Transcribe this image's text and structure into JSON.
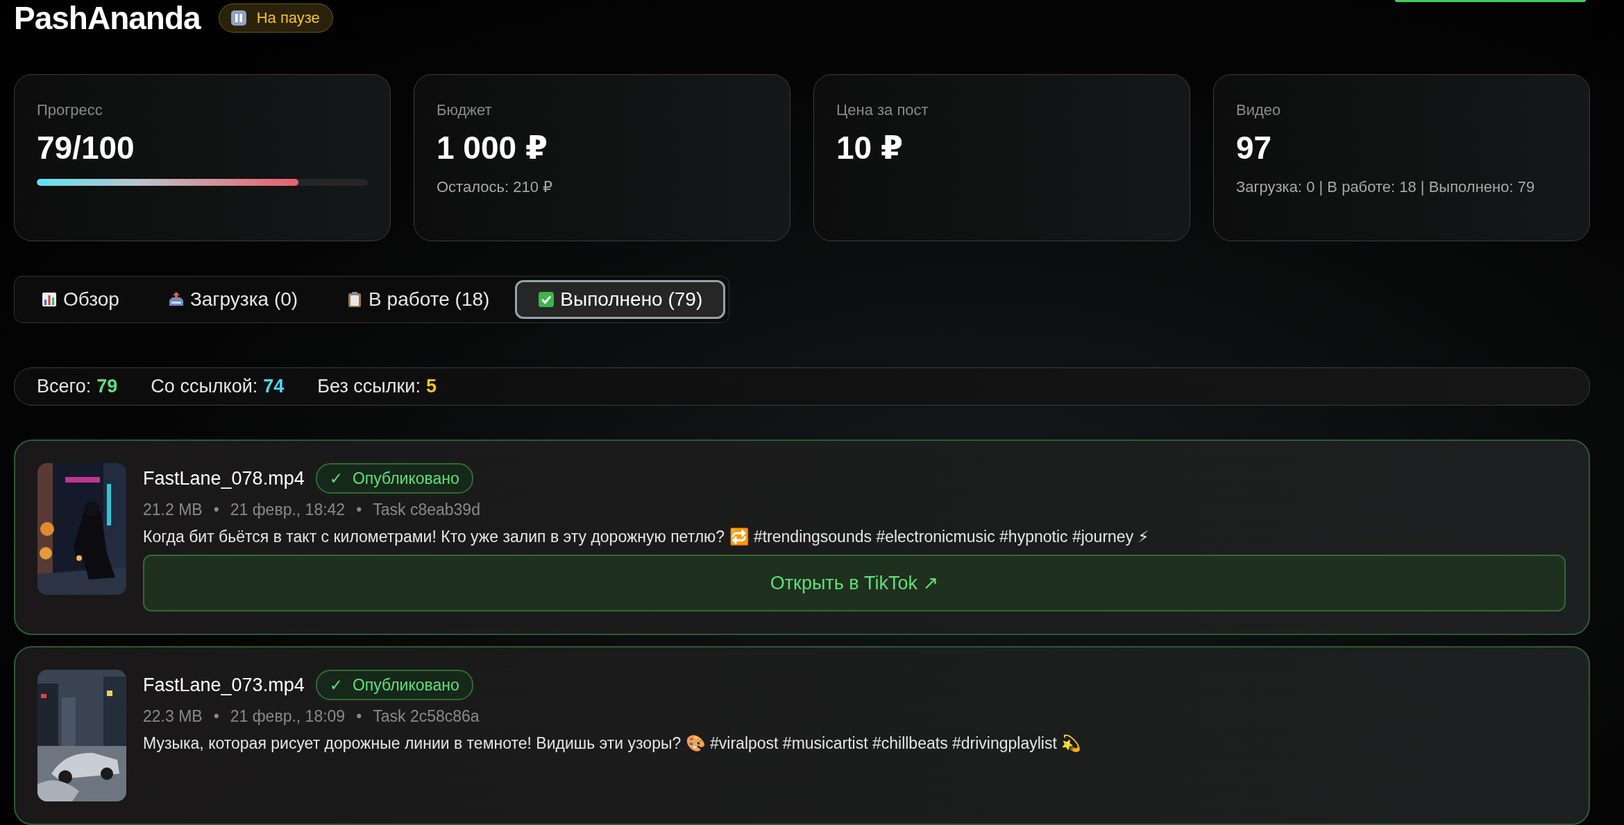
{
  "header": {
    "title": "PashAnanda",
    "status": {
      "kind": "paused",
      "label": "На паузе"
    }
  },
  "stats": [
    {
      "kind": "progress",
      "label": "Прогресс",
      "value": "79/100",
      "level": 0.79
    },
    {
      "kind": "plain",
      "label": "Бюджет",
      "value": "1 000 ₽",
      "note": "Осталось: 210 ₽"
    },
    {
      "kind": "plain",
      "label": "Цена за пост",
      "value": "10 ₽"
    },
    {
      "kind": "plain",
      "label": "Видео",
      "value": "97",
      "note": "Загрузка: 0 | В работе: 18 | Выполнено: 79"
    }
  ],
  "tabs": [
    {
      "label": "Обзор",
      "selected": false
    },
    {
      "label": "Загрузка (0)",
      "selected": false
    },
    {
      "label": "В работе (18)",
      "selected": false
    },
    {
      "label": "Выполнено (79)",
      "selected": true
    }
  ],
  "summary": [
    {
      "label": "Всего:",
      "value": "79",
      "color": "#5ee07a"
    },
    {
      "label": "Со ссылкой:",
      "value": "74",
      "color": "#4fd8f0"
    },
    {
      "label": "Без ссылки:",
      "value": "5",
      "color": "#f5c518"
    }
  ],
  "videos": [
    {
      "name": "FastLane_078.mp4",
      "status": {
        "mark": "✓",
        "label": "Опубликовано"
      },
      "meta": [
        "21.2 MB",
        "•",
        "21 февр., 18:42",
        "•",
        "Task c8eab39d"
      ],
      "caption": "Когда бит бьётся в такт с километрами! Кто уже залип в эту дорожную петлю? 🔁 #trendingsounds #electronicmusic #hypnotic #journey ⚡",
      "button": "Открыть в TikTok ↗"
    },
    {
      "name": "FastLane_073.mp4",
      "status": {
        "mark": "✓",
        "label": "Опубликовано"
      },
      "meta": [
        "22.3 MB",
        "•",
        "21 февр., 18:09",
        "•",
        "Task 2c58c86a"
      ],
      "caption": "Музыка, которая рисует дорожные линии в темноте! Видишь эти узоры? 🎨 #viralpost #musicartist #chillbeats #drivingplaylist 💫"
    }
  ]
}
